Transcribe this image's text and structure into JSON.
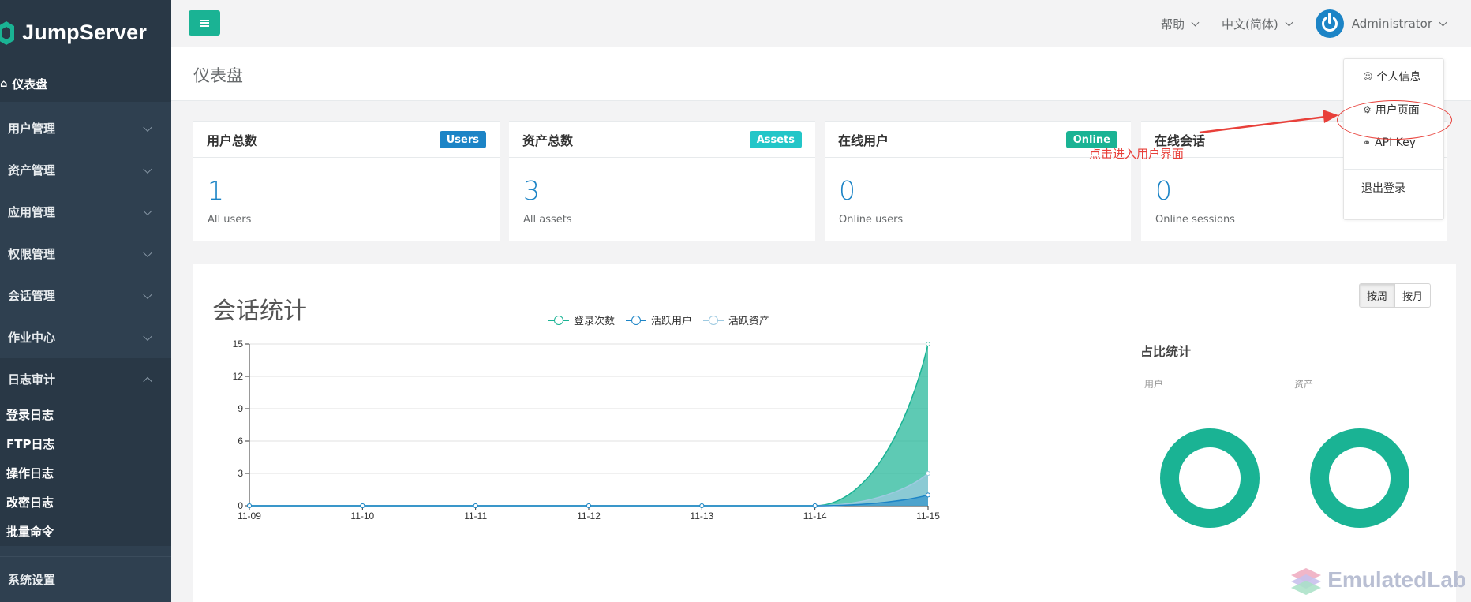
{
  "app": {
    "logo_text": "JumpServer"
  },
  "sidebar": {
    "items": [
      {
        "label": "仪表盘",
        "active": true
      },
      {
        "label": "用户管理"
      },
      {
        "label": "资产管理"
      },
      {
        "label": "应用管理"
      },
      {
        "label": "权限管理"
      },
      {
        "label": "会话管理"
      },
      {
        "label": "作业中心"
      },
      {
        "label": "日志审计",
        "expanded": true
      }
    ],
    "audit_children": [
      "登录日志",
      "FTP日志",
      "操作日志",
      "改密日志",
      "批量命令"
    ],
    "bottom_item": "系统设置"
  },
  "topbar": {
    "help": "帮助",
    "language": "中文(简体)",
    "user": "Administrator"
  },
  "page_title": "仪表盘",
  "cards": [
    {
      "title": "用户总数",
      "badge": "Users",
      "badge_color": "#1c84c6",
      "value": "1",
      "sub": "All users"
    },
    {
      "title": "资产总数",
      "badge": "Assets",
      "badge_color": "#23c6c8",
      "value": "3",
      "sub": "All assets"
    },
    {
      "title": "在线用户",
      "badge": "Online",
      "badge_color": "#1ab394",
      "value": "0",
      "sub": "Online users"
    },
    {
      "title": "在线会话",
      "badge": "",
      "badge_color": "#1ab394",
      "value": "0",
      "sub": "Online sessions"
    }
  ],
  "session_panel": {
    "title": "会话统计",
    "toggle": [
      "按周",
      "按月"
    ],
    "ratio_title": "占比统计",
    "ratio_labels": [
      "用户",
      "资产"
    ]
  },
  "dropdown": {
    "items": [
      "个人信息",
      "用户页面",
      "API Key"
    ],
    "logout": "退出登录"
  },
  "annotation": {
    "text": "点击进入用户界面"
  },
  "watermark": "EmulatedLab",
  "colors": {
    "sidebar": "#2f4050",
    "primary": "#1ab394",
    "blue": "#1c84c6",
    "annotation": "#e8403a"
  },
  "chart_data": {
    "type": "area",
    "x": [
      "11-09",
      "11-10",
      "11-11",
      "11-12",
      "11-13",
      "11-14",
      "11-15"
    ],
    "ylim": [
      0,
      15
    ],
    "yticks": [
      0,
      3,
      6,
      9,
      12,
      15
    ],
    "series": [
      {
        "name": "登录次数",
        "color": "#1ab394",
        "values": [
          0,
          0,
          0,
          0,
          0,
          0,
          15
        ]
      },
      {
        "name": "活跃用户",
        "color": "#1c84c6",
        "values": [
          0,
          0,
          0,
          0,
          0,
          0,
          1
        ]
      },
      {
        "name": "活跃资产",
        "color": "#9ecae1",
        "values": [
          0,
          0,
          0,
          0,
          0,
          0,
          3
        ]
      }
    ]
  }
}
